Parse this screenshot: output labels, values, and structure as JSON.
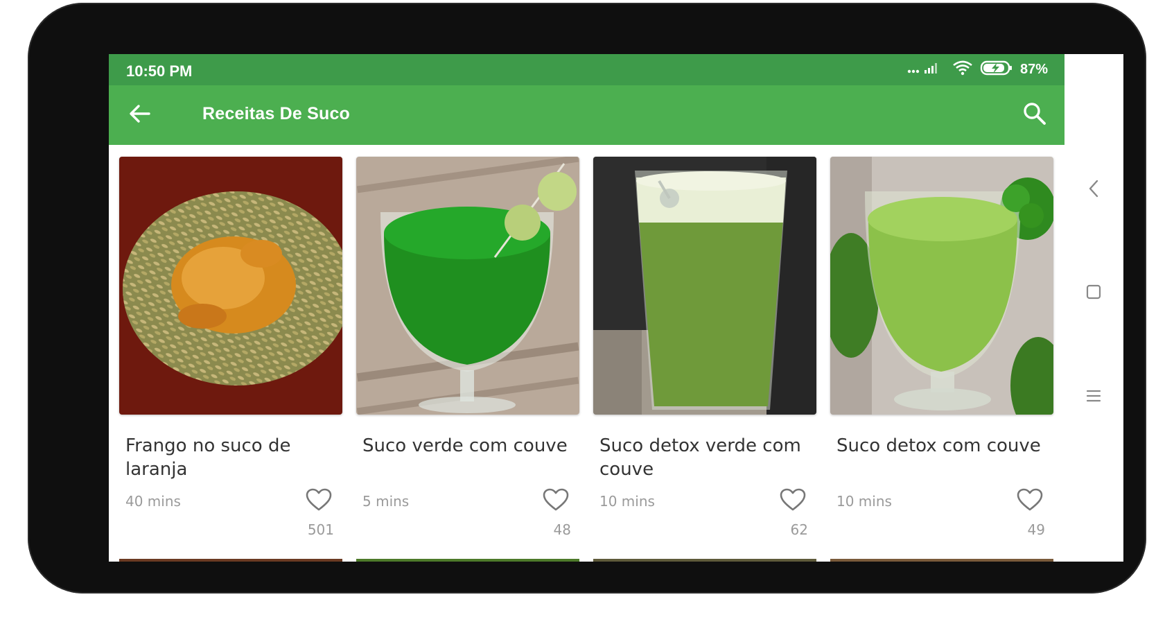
{
  "status_bar": {
    "time": "10:50 PM",
    "battery": "87%"
  },
  "app_bar": {
    "title": "Receitas De Suco"
  },
  "recipes": [
    {
      "title": "Frango no suco de laranja",
      "time": "40 mins",
      "likes": "501"
    },
    {
      "title": "Suco verde com couve",
      "time": "5 mins",
      "likes": "48"
    },
    {
      "title": "Suco detox verde com couve",
      "time": "10 mins",
      "likes": "62"
    },
    {
      "title": "Suco detox com couve",
      "time": "10 mins",
      "likes": "49"
    }
  ],
  "icons": {
    "back": "arrow-left-icon",
    "search": "search-icon",
    "favorite": "heart-outline-icon",
    "nav_back": "chevron-left-icon",
    "nav_home": "square-icon",
    "nav_recents": "menu-icon"
  },
  "colors": {
    "status_bar": "#3e9b4a",
    "app_bar": "#4caf50",
    "text_primary": "#333333",
    "text_secondary": "#9a9a9a"
  }
}
